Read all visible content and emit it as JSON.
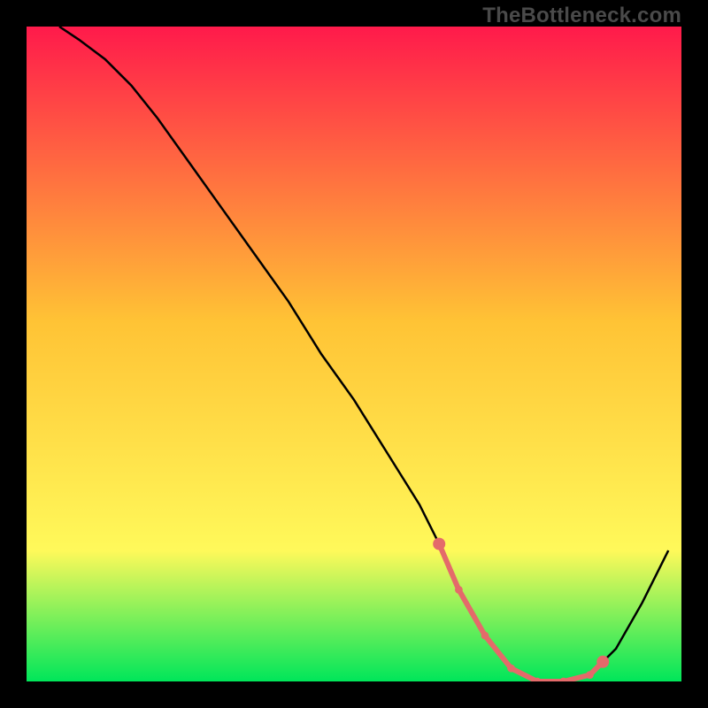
{
  "watermark": "TheBottleneck.com",
  "colors": {
    "gradient_top": "#ff1a4b",
    "gradient_mid": "#ffc335",
    "gradient_low": "#fff95a",
    "gradient_bottom": "#00e65a",
    "curve": "#000000",
    "segment": "#e46a6a",
    "frame": "#000000"
  },
  "chart_data": {
    "type": "line",
    "title": "",
    "xlabel": "",
    "ylabel": "",
    "xlim": [
      0,
      100
    ],
    "ylim": [
      0,
      100
    ],
    "series": [
      {
        "name": "bottleneck-curve",
        "x": [
          5,
          8,
          12,
          16,
          20,
          25,
          30,
          35,
          40,
          45,
          50,
          55,
          60,
          63,
          66,
          70,
          74,
          78,
          82,
          86,
          90,
          94,
          98
        ],
        "y": [
          100,
          98,
          95,
          91,
          86,
          79,
          72,
          65,
          58,
          50,
          43,
          35,
          27,
          21,
          14,
          7,
          2,
          0,
          0,
          1,
          5,
          12,
          20
        ]
      }
    ],
    "highlight_segment": {
      "name": "optimal-range",
      "points_x": [
        63,
        66,
        70,
        74,
        78,
        82,
        86,
        88
      ],
      "points_y": [
        21,
        14,
        7,
        2,
        0,
        0,
        1,
        3
      ],
      "dot_radius_major": 3.2,
      "dot_radius_minor": 2.0
    },
    "grid": false,
    "legend": false
  }
}
